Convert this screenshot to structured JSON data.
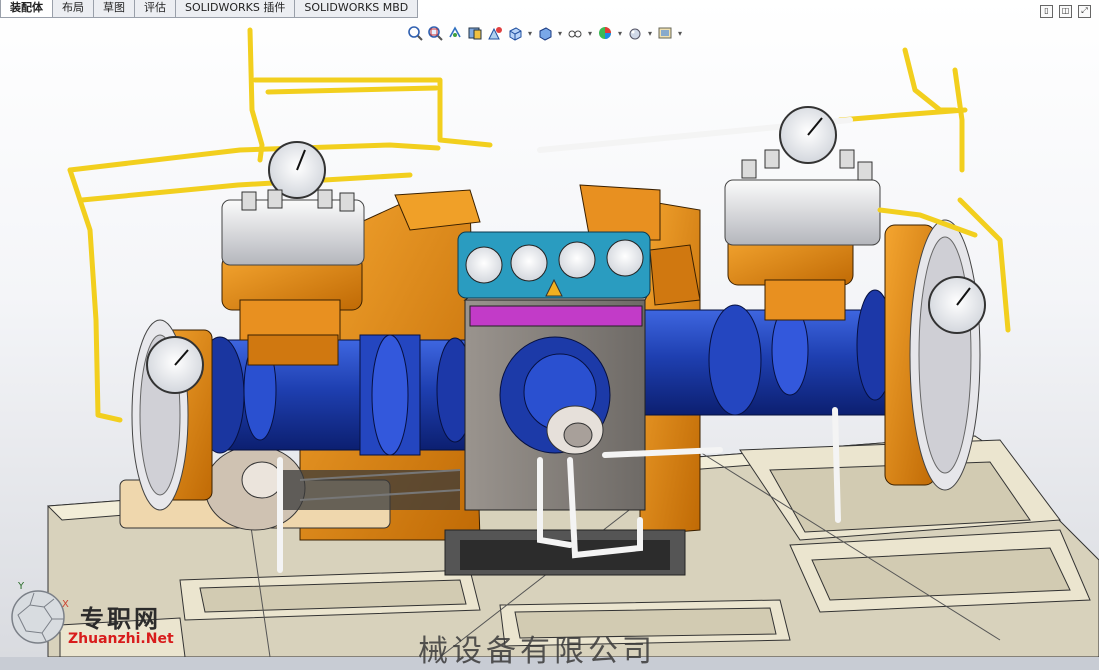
{
  "tabs": [
    {
      "label": "装配体",
      "active": true
    },
    {
      "label": "布局",
      "active": false
    },
    {
      "label": "草图",
      "active": false
    },
    {
      "label": "评估",
      "active": false
    },
    {
      "label": "SOLIDWORKS 插件",
      "active": false
    },
    {
      "label": "SOLIDWORKS MBD",
      "active": false
    }
  ],
  "heads_up_toolbar": [
    "zoom-to-fit-icon",
    "zoom-area-icon",
    "previous-view-icon",
    "section-view-icon",
    "dynamic-annotation-icon",
    "view-orientation-icon",
    "display-style-icon",
    "hide-show-items-icon",
    "edit-appearance-icon",
    "apply-scene-icon",
    "view-settings-icon"
  ],
  "watermark": {
    "cn": "专职网",
    "en": "Zhuanzhi.Net"
  },
  "model_text": "械设备有限公司",
  "colors": {
    "frame": "#e8e2cc",
    "body_orange": "#e08a10",
    "cylinder_blue": "#1e3fb0",
    "pipe_yellow": "#f2cf1e",
    "crankcase": "#8a8480",
    "panel_teal": "#2a9cc0",
    "accent_magenta": "#c23bc8"
  }
}
